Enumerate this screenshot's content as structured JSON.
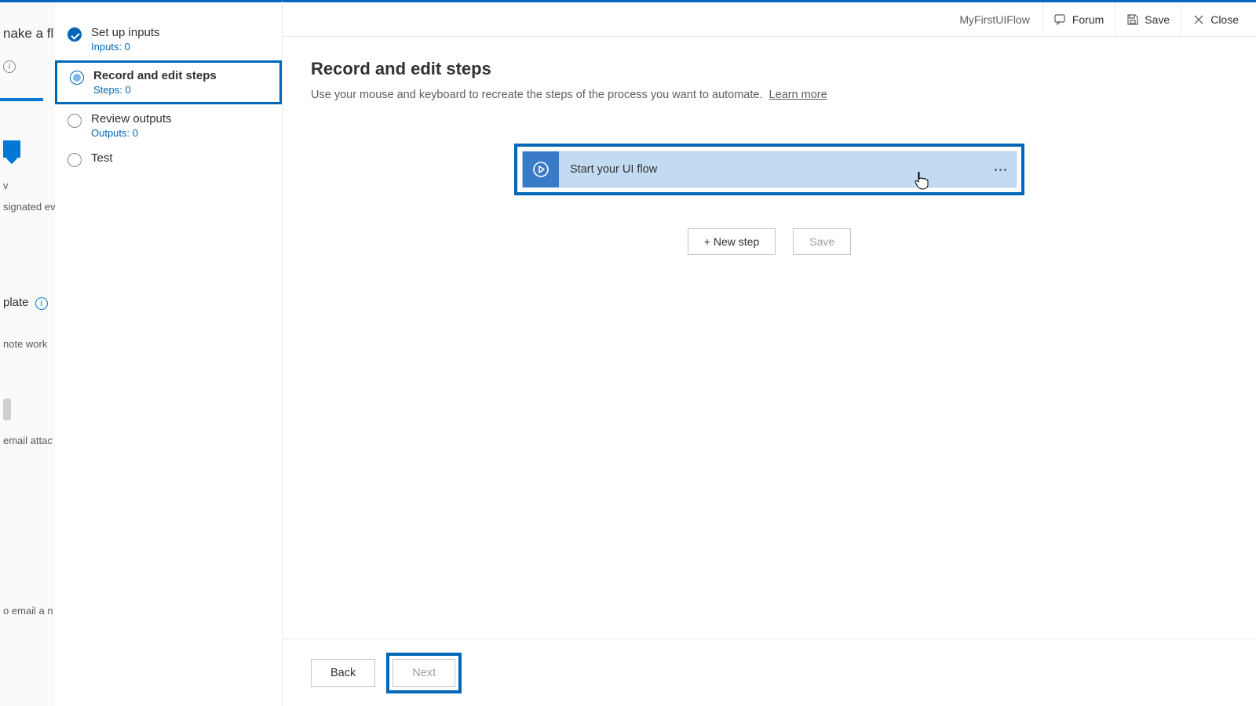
{
  "background": {
    "heading_fragment": "nake a fl",
    "row1": "v",
    "row2": "signated even",
    "template_label": "plate",
    "row3": "note work",
    "row4": "email attac",
    "row5": "o email a n"
  },
  "nav": {
    "items": [
      {
        "label": "Set up inputs",
        "sub": "Inputs: 0"
      },
      {
        "label": "Record and edit steps",
        "sub": "Steps: 0"
      },
      {
        "label": "Review outputs",
        "sub": "Outputs: 0"
      },
      {
        "label": "Test",
        "sub": ""
      }
    ]
  },
  "topbar": {
    "title": "MyFirstUIFlow",
    "forum": "Forum",
    "save": "Save",
    "close": "Close"
  },
  "main": {
    "heading": "Record and edit steps",
    "description": "Use your mouse and keyboard to recreate the steps of the process you want to automate.",
    "learn_more": "Learn more",
    "card_label": "Start your UI flow",
    "new_step": "+ New step",
    "save_step": "Save"
  },
  "footer": {
    "back": "Back",
    "next": "Next"
  }
}
